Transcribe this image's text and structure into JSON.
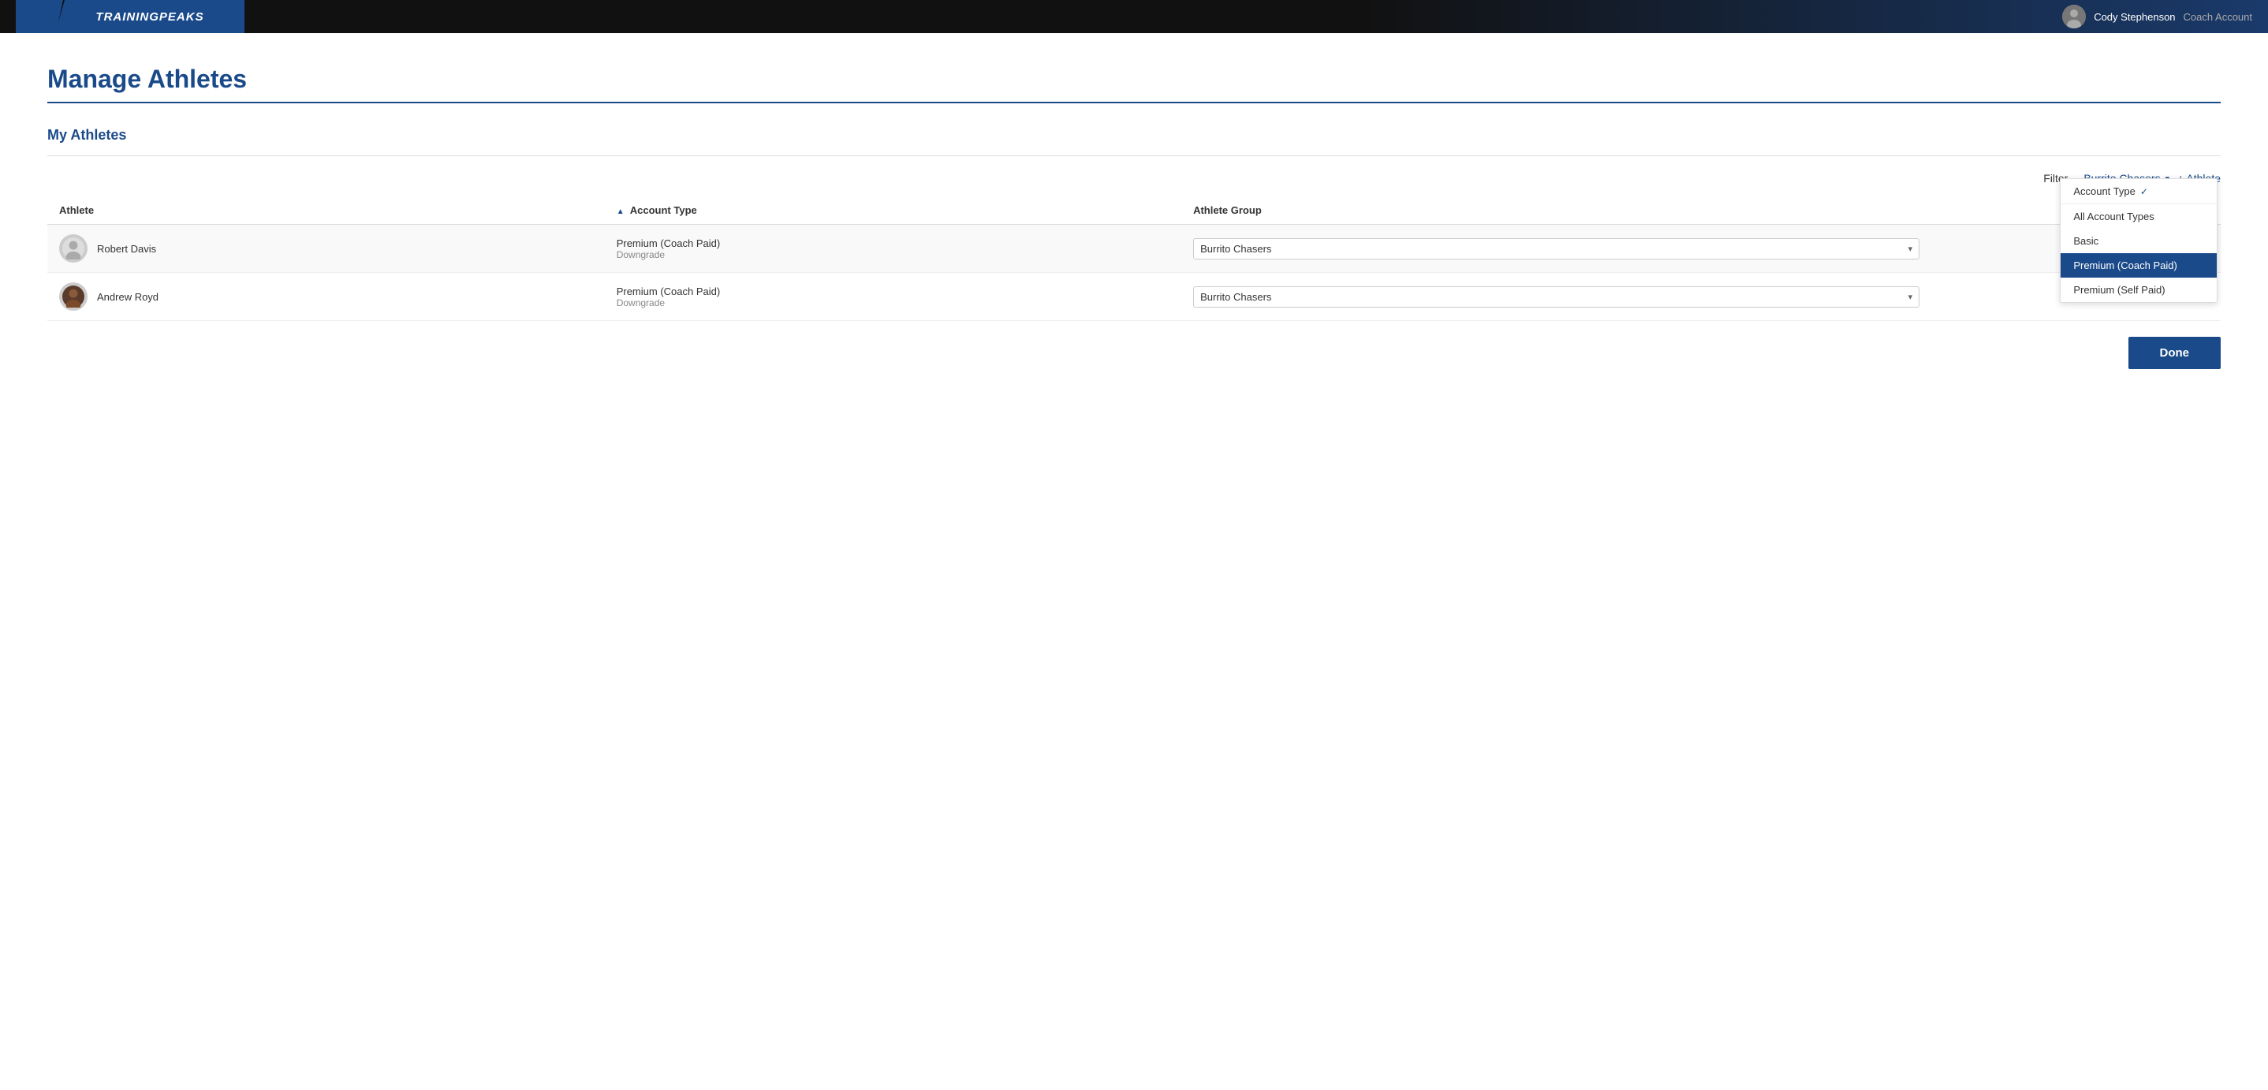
{
  "header": {
    "logo_text": "TRAININGPEAKS",
    "user_name": "Cody Stephenson",
    "user_role": "Coach Account"
  },
  "page": {
    "title": "Manage Athletes",
    "section": "My Athletes"
  },
  "filter": {
    "label": "Filter",
    "account_type_label": "Account Type",
    "account_type_checkmark": "✓",
    "group_filter": "Burrito Chasers",
    "group_chevron": "▾",
    "account_type_chevron": "▾"
  },
  "dropdown": {
    "header": "Account Type",
    "options": [
      {
        "id": "all",
        "label": "All Account Types",
        "selected": false
      },
      {
        "id": "basic",
        "label": "Basic",
        "selected": false
      },
      {
        "id": "premium_coach",
        "label": "Premium (Coach Paid)",
        "selected": true
      },
      {
        "id": "premium_self",
        "label": "Premium (Self Paid)",
        "selected": false
      }
    ]
  },
  "table": {
    "columns": [
      "Athlete",
      "Account Type",
      "Athlete Group"
    ],
    "sort_icon": "▲",
    "add_athlete_label": "+ Athlete",
    "athletes": [
      {
        "id": 1,
        "name": "Robert Davis",
        "account_type": "Premium (Coach Paid)",
        "account_sub": "Downgrade",
        "group": "Burrito Chasers",
        "has_photo": false
      },
      {
        "id": 2,
        "name": "Andrew Royd",
        "account_type": "Premium (Coach Paid)",
        "account_sub": "Downgrade",
        "group": "Burrito Chasers",
        "has_photo": true
      }
    ]
  },
  "actions": {
    "done_label": "Done",
    "delete_icon": "🗑",
    "share_icon": "↗"
  },
  "colors": {
    "primary_blue": "#1a4a8a",
    "selected_bg": "#1a4a8a",
    "selected_text": "#ffffff"
  }
}
